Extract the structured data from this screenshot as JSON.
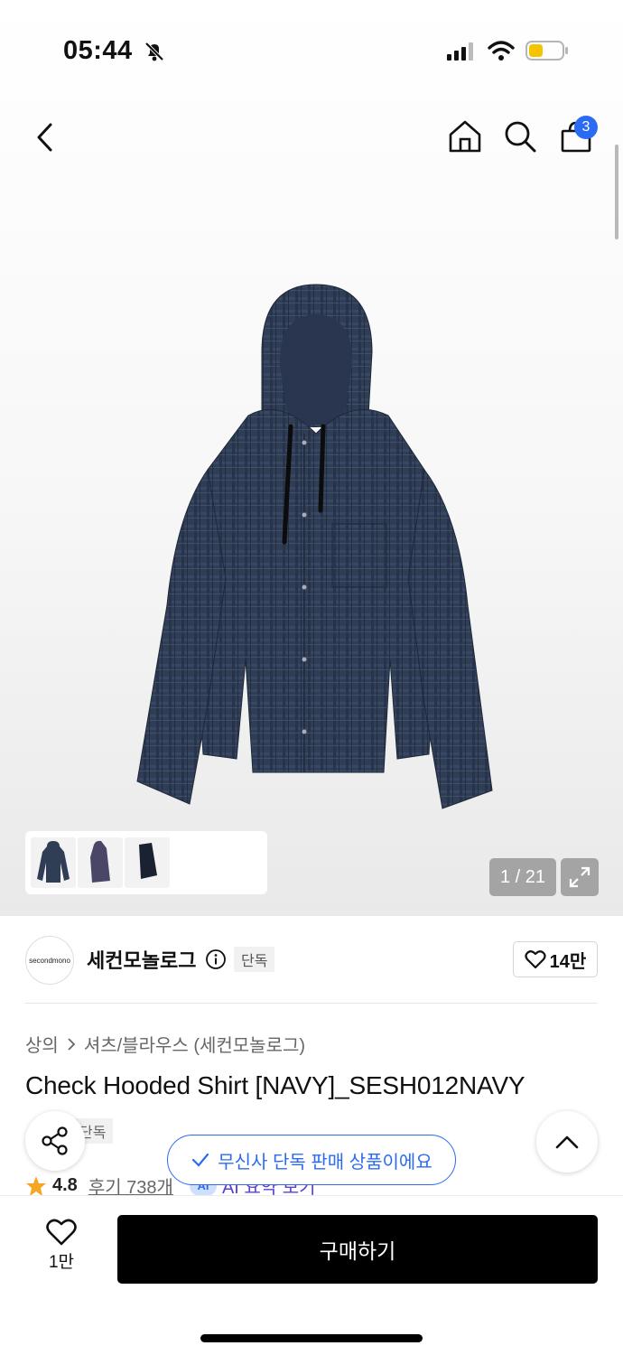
{
  "status_bar": {
    "time": "05:44"
  },
  "nav": {
    "cart_count": "3"
  },
  "gallery": {
    "page_counter": "1 / 21"
  },
  "brand": {
    "logo_text": "secondmono",
    "name": "세컨모놀로그",
    "exclusive": "단독",
    "likes": "14만"
  },
  "product": {
    "breadcrumb_category": "상의",
    "breadcrumb_sub": "셔츠/블라우스 (세컨모놀로그)",
    "title": "Check Hooded Shirt [NAVY]_SESH012NAVY",
    "exclusive": "단독",
    "rating": "4.8",
    "review_text": "후기 738개",
    "ai_label": "AI",
    "ai_summary": "AI 요약 보기"
  },
  "toast": {
    "text": "무신사 단독 판매 상품이에요"
  },
  "bottom": {
    "wish_count": "1만",
    "buy_label": "구매하기"
  },
  "colors": {
    "accent": "#2b6bf3",
    "buy_button": "#000000",
    "star": "#f5a623"
  }
}
